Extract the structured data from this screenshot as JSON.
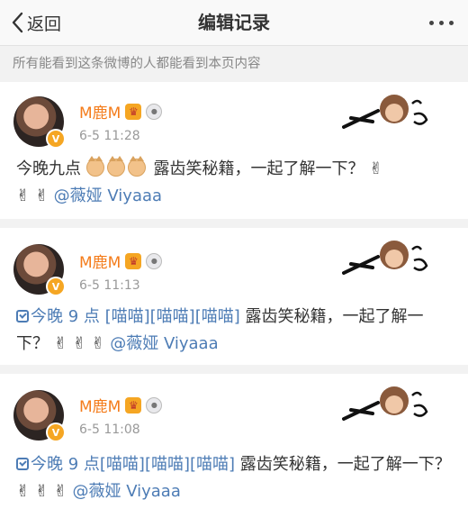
{
  "nav": {
    "back_label": "返回",
    "title": "编辑记录"
  },
  "notice": "所有能看到这条微博的人都能看到本页内容",
  "records": [
    {
      "username": "M鹿M",
      "time": "6-5 11:28",
      "text_main": "今晚九点",
      "text_after": "露齿笑秘籍，一起了解一下？",
      "victory_emoji": "✌",
      "mention": "@薇娅 Viyaaa"
    },
    {
      "username": "M鹿M",
      "time": "6-5 11:13",
      "topic": "今晚 9 点 [喵喵][喵喵][喵喵]",
      "text_after": "露齿笑秘籍，一起了解一下？",
      "victory_emoji": "✌",
      "mention": "@薇娅 Viyaaa"
    },
    {
      "username": "M鹿M",
      "time": "6-5 11:08",
      "topic": "今晚 9 点[喵喵][喵喵][喵喵]",
      "text_after": "露齿笑秘籍，一起了解一下？",
      "victory_emoji": "✌",
      "mention": "@薇娅 Viyaaa"
    }
  ],
  "icons": {
    "back": "chevron-left-icon",
    "more": "more-dots-icon",
    "verified": "verified-v-icon",
    "crown": "crown-icon",
    "medal": "medal-icon",
    "cat": "cat-emoji-icon",
    "topic": "topic-check-icon"
  },
  "colors": {
    "username": "#f47c1b",
    "link": "#4d7cb5",
    "meta": "#999999",
    "background": "#f2f2f2"
  }
}
